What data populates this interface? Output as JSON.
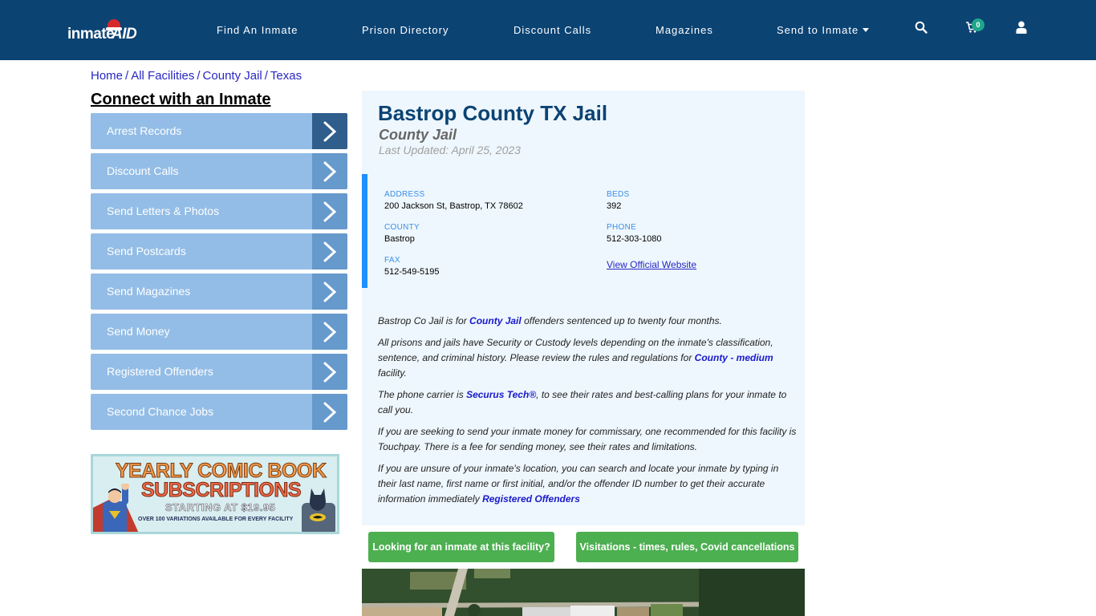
{
  "header": {
    "logo": {
      "part1": "inmate",
      "part2": "AID"
    },
    "nav": [
      {
        "label": "Find An Inmate"
      },
      {
        "label": "Prison Directory"
      },
      {
        "label": "Discount Calls"
      },
      {
        "label": "Magazines"
      },
      {
        "label": "Send to Inmate",
        "has_dropdown": true
      }
    ],
    "icons": [
      "search-icon",
      "cart-icon",
      "user-icon"
    ],
    "cart_count": "0",
    "colors": {
      "bar": "#0b4373",
      "badge": "#1fa78b"
    }
  },
  "breadcrumb": [
    {
      "label": "Home"
    },
    {
      "label": "All Facilities"
    },
    {
      "label": "County Jail"
    },
    {
      "label": "Texas"
    }
  ],
  "sidebar": {
    "title": "Connect with an Inmate",
    "items": [
      {
        "label": "Arrest Records",
        "active": true
      },
      {
        "label": "Discount Calls"
      },
      {
        "label": "Send Letters & Photos"
      },
      {
        "label": "Send Postcards"
      },
      {
        "label": "Send Magazines"
      },
      {
        "label": "Send Money"
      },
      {
        "label": "Registered Offenders"
      },
      {
        "label": "Second Chance Jobs"
      }
    ],
    "ad": {
      "line1": "YEARLY COMIC BOOK",
      "line2": "SUBSCRIPTIONS",
      "line3": "STARTING AT $19.95",
      "line4": "OVER 100 VARIATIONS AVAILABLE FOR EVERY FACILITY"
    }
  },
  "facility": {
    "name": "Bastrop County TX Jail",
    "type": "County Jail",
    "last_updated": "Last Updated: April 25, 2023",
    "details": {
      "address_label": "ADDRESS",
      "address": "200 Jackson St, Bastrop, TX 78602",
      "beds_label": "BEDS",
      "beds": "392",
      "county_label": "COUNTY",
      "county": "Bastrop",
      "phone_label": "PHONE",
      "phone": "512-303-1080",
      "fax_label": "FAX",
      "fax": "512-549-5195",
      "website_link": "View Official Website"
    },
    "description": {
      "p1_a": "Bastrop Co Jail is for ",
      "p1_link": "County Jail",
      "p1_b": " offenders sentenced up to twenty four months.",
      "p2_a": "All prisons and jails have Security or Custody levels depending on the inmate's classification, sentence, and criminal history. Please review the rules and regulations for ",
      "p2_link": "County - medium",
      "p2_b": " facility.",
      "p3_a": "The phone carrier is ",
      "p3_link": "Securus Tech®",
      "p3_b": ", to see their rates and best-calling plans for your inmate to call you.",
      "p4": "If you are seeking to send your inmate money for commissary, one recommended for this facility is Touchpay. There is a fee for sending money, see their rates and limitations.",
      "p5_a": "If you are unsure of your inmate's location, you can search and locate your inmate by typing in their last name, first name or first initial, and/or the offender ID number to get their accurate information immediately ",
      "p5_link": "Registered Offenders"
    },
    "buttons": {
      "find_inmate": "Looking for an inmate at this facility?",
      "visitations": "Visitations - times, rules, Covid cancellations"
    },
    "colors": {
      "title": "#0b4373",
      "panel_bg": "#eef7fd",
      "accent_border": "#1e90ff",
      "button": "#4caf50"
    }
  }
}
